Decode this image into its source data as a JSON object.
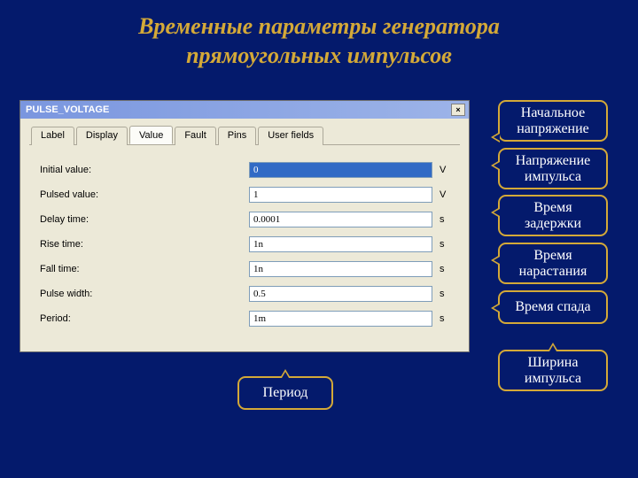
{
  "title_line1": "Временные параметры генератора",
  "title_line2": "прямоугольных импульсов",
  "dialog": {
    "title": "PULSE_VOLTAGE",
    "close": "×",
    "tabs": {
      "label": "Label",
      "display": "Display",
      "value": "Value",
      "fault": "Fault",
      "pins": "Pins",
      "userfields": "User fields"
    },
    "rows": {
      "initial": {
        "label": "Initial value:",
        "value": "0",
        "unit": "V"
      },
      "pulsed": {
        "label": "Pulsed value:",
        "value": "1",
        "unit": "V"
      },
      "delay": {
        "label": "Delay time:",
        "value": "0.0001",
        "unit": "s"
      },
      "rise": {
        "label": "Rise time:",
        "value": "1n",
        "unit": "s"
      },
      "fall": {
        "label": "Fall time:",
        "value": "1n",
        "unit": "s"
      },
      "pulsew": {
        "label": "Pulse width:",
        "value": "0.5",
        "unit": "s"
      },
      "period": {
        "label": "Period:",
        "value": "1m",
        "unit": "s"
      }
    }
  },
  "callouts": {
    "initial": "Начальное напряжение",
    "pulsed": "Напряжение импульса",
    "delay": "Время задержки",
    "rise": "Время нарастания",
    "fall": "Время спада",
    "pulsew": "Ширина импульса",
    "period": "Период"
  }
}
